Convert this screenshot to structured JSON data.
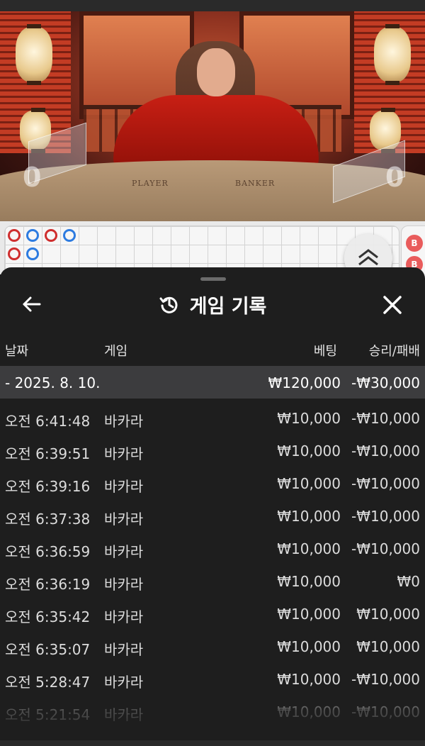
{
  "video": {
    "table_labels": [
      "PLAYER",
      "BANKER"
    ],
    "player_score": "0",
    "banker_score": "0"
  },
  "roadmap": {
    "beads_row1": [
      "red",
      "blue",
      "red",
      "blue"
    ],
    "beads_row2": [
      "red",
      "blue"
    ],
    "side_labels": [
      "B",
      "B"
    ]
  },
  "sheet": {
    "title": "게임 기록",
    "columns": {
      "date": "날짜",
      "game": "게임",
      "bet": "베팅",
      "result": "승리/패배"
    },
    "summary": {
      "date": "- 2025. 8. 10.",
      "bet": "₩120,000",
      "result": "-₩30,000"
    },
    "rows": [
      {
        "time": "오전 6:41:48",
        "game": "바카라",
        "bet": "₩10,000",
        "result": "-₩10,000"
      },
      {
        "time": "오전 6:39:51",
        "game": "바카라",
        "bet": "₩10,000",
        "result": "-₩10,000"
      },
      {
        "time": "오전 6:39:16",
        "game": "바카라",
        "bet": "₩10,000",
        "result": "-₩10,000"
      },
      {
        "time": "오전 6:37:38",
        "game": "바카라",
        "bet": "₩10,000",
        "result": "-₩10,000"
      },
      {
        "time": "오전 6:36:59",
        "game": "바카라",
        "bet": "₩10,000",
        "result": "-₩10,000"
      },
      {
        "time": "오전 6:36:19",
        "game": "바카라",
        "bet": "₩10,000",
        "result": "₩0"
      },
      {
        "time": "오전 6:35:42",
        "game": "바카라",
        "bet": "₩10,000",
        "result": "₩10,000"
      },
      {
        "time": "오전 6:35:07",
        "game": "바카라",
        "bet": "₩10,000",
        "result": "₩10,000"
      },
      {
        "time": "오전 5:28:47",
        "game": "바카라",
        "bet": "₩10,000",
        "result": "-₩10,000"
      },
      {
        "time": "오전 5:21:54",
        "game": "바카라",
        "bet": "₩10,000",
        "result": "-₩10,000"
      }
    ]
  }
}
